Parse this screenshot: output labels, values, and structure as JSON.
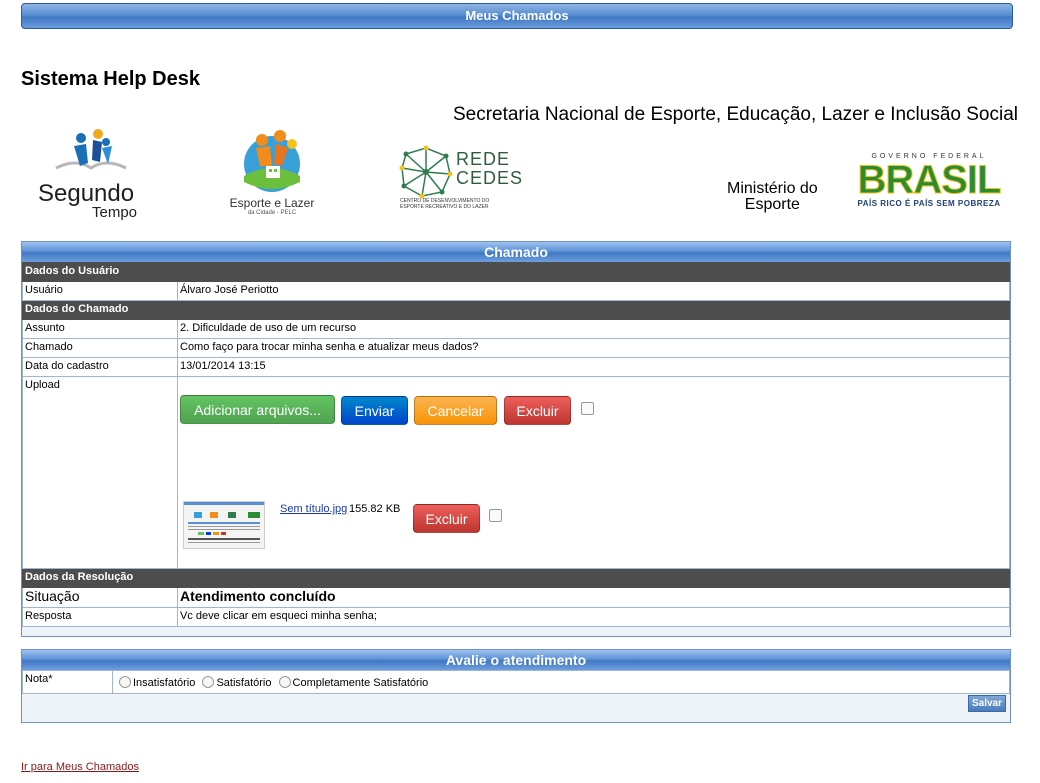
{
  "header": {
    "bar_title": "Meus Chamados",
    "app_title": "Sistema Help Desk",
    "secretaria": "Secretaria Nacional de Esporte, Educação, Lazer e Inclusão Social"
  },
  "logos": {
    "segundo_tempo": {
      "line1": "Segundo",
      "line2": "Tempo"
    },
    "esporte_lazer": {
      "line1": "Esporte e Lazer",
      "line2": "da Cidade - PELC"
    },
    "rede_cedes": {
      "line1": "REDE",
      "line2": "CEDES",
      "sub1": "CENTRO DE DESENVOLVIMENTO DO",
      "sub2": "ESPORTE RECREATIVO E DO LAZER"
    },
    "ministerio": {
      "line1": "Ministério do",
      "line2": "Esporte"
    },
    "brasil": {
      "top": "GOVERNO FEDERAL",
      "word": "BRASIL",
      "slogan": "PAÍS RICO É PAÍS SEM POBREZA"
    }
  },
  "chamado": {
    "title": "Chamado",
    "dados_usuario": "Dados do Usuário",
    "usuario_label": "Usuário",
    "usuario_value": "Álvaro José Periotto",
    "dados_chamado": "Dados do Chamado",
    "assunto_label": "Assunto",
    "assunto_value": "2. Dificuldade de uso de um recurso",
    "chamado_label": "Chamado",
    "chamado_value": "Como faço para trocar minha senha e atualizar meus dados?",
    "data_label": "Data do cadastro",
    "data_value": "13/01/2014 13:15",
    "upload_label": "Upload",
    "buttons": {
      "add": "Adicionar arquivos...",
      "send": "Enviar",
      "cancel": "Cancelar",
      "delete": "Excluir"
    },
    "file": {
      "name": "Sem título.jpg",
      "size": "155.82 KB",
      "delete": "Excluir"
    },
    "dados_resolucao": "Dados da Resolução",
    "situacao_label": "Situação",
    "situacao_value": "Atendimento concluído",
    "resposta_label": "Resposta",
    "resposta_value": "Vc deve clicar em esqueci minha senha;"
  },
  "avaliacao": {
    "title": "Avalie o atendimento",
    "nota_label": "Nota*",
    "options": [
      "Insatisfatório",
      "Satisfatório",
      "Completamente Satisfatório"
    ],
    "save": "Salvar"
  },
  "footer_link": "Ir para Meus Chamados"
}
